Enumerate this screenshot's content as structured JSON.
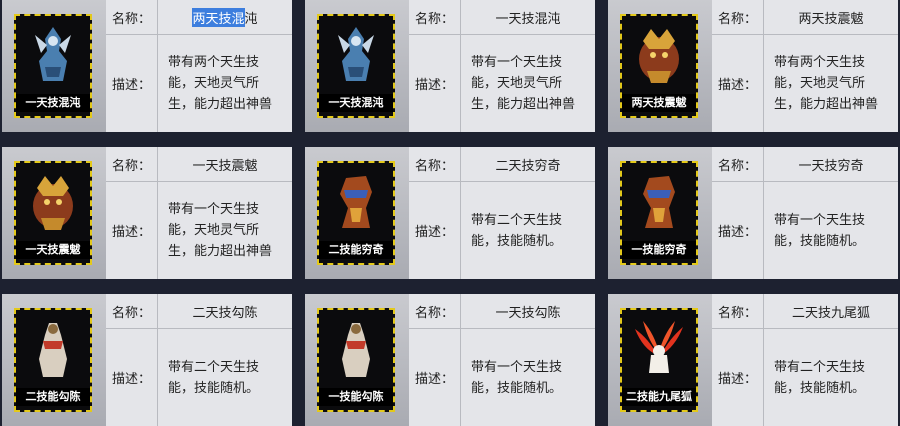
{
  "labels": {
    "name": "名称：",
    "desc": "描述："
  },
  "cards": [
    {
      "caption": "一天技混沌",
      "name_selected": "两天技混",
      "name_rest": "沌",
      "desc": "带有两个天生技能，天地灵气所生，能力超出神兽"
    },
    {
      "caption": "一天技混沌",
      "name_selected": "",
      "name_rest": "一天技混沌",
      "desc": "带有一个天生技能，天地灵气所生，能力超出神兽"
    },
    {
      "caption": "两天技震魃",
      "name_selected": "",
      "name_rest": "两天技震魃",
      "desc": "带有两个天生技能，天地灵气所生，能力超出神兽"
    },
    {
      "caption": "一天技震魃",
      "name_selected": "",
      "name_rest": "一天技震魃",
      "desc": "带有一个天生技能，天地灵气所生，能力超出神兽"
    },
    {
      "caption": "二技能穷奇",
      "name_selected": "",
      "name_rest": "二天技穷奇",
      "desc": "带有二个天生技能，技能随机。"
    },
    {
      "caption": "一技能穷奇",
      "name_selected": "",
      "name_rest": "一天技穷奇",
      "desc": "带有一个天生技能，技能随机。"
    },
    {
      "caption": "二技能勾陈",
      "name_selected": "",
      "name_rest": "二天技勾陈",
      "desc": "带有二个天生技能，技能随机。"
    },
    {
      "caption": "一技能勾陈",
      "name_selected": "",
      "name_rest": "一天技勾陈",
      "desc": "带有一个天生技能，技能随机。"
    },
    {
      "caption": "二技能九尾狐",
      "name_selected": "",
      "name_rest": "二天技九尾狐",
      "desc": "带有二个天生技能，技能随机。"
    }
  ],
  "icons": [
    "chaos-beast-icon",
    "chaos-beast-icon",
    "zhenba-beast-icon",
    "zhenba-beast-icon",
    "qiongqi-beast-icon",
    "qiongqi-beast-icon",
    "gouchen-beast-icon",
    "gouchen-beast-icon",
    "ninetail-fox-icon"
  ],
  "colors": {
    "frame_border": "#e3c91a",
    "selection": "#3d7ede",
    "page_bg": "#1d2130"
  }
}
